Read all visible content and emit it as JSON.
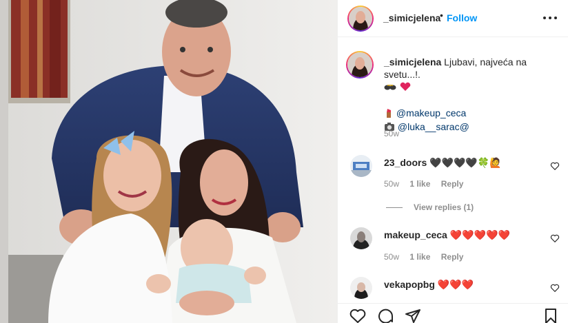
{
  "post": {
    "username": "_simicjelena",
    "follow_label": "Follow",
    "dot": "•",
    "caption_text": "Ljubavi, najveća na svetu...!.",
    "caption_mention_1": "@makeup_ceca",
    "caption_mention_2": "@luka__sarac",
    "caption_mention_2_suffix": "@",
    "caption_time": "50w"
  },
  "comments": [
    {
      "username": "23_doors",
      "text": "🖤🖤🖤🖤🍀🙋",
      "time": "50w",
      "likes": "1 like",
      "reply": "Reply"
    },
    {
      "username": "makeup_ceca",
      "text": "❤️❤️❤️❤️❤️",
      "time": "50w",
      "likes": "1 like",
      "reply": "Reply"
    },
    {
      "username": "vekapopbg",
      "text": "❤️❤️❤️"
    }
  ],
  "view_replies": "View replies (1)",
  "icons": {
    "more": "more-horizontal-icon",
    "like": "heart-icon",
    "comment": "comment-icon",
    "share": "paper-plane-icon",
    "save": "bookmark-icon"
  },
  "colors": {
    "follow": "#0095f6",
    "mention": "#00376b",
    "muted": "#8e8e8e",
    "text": "#262626"
  }
}
